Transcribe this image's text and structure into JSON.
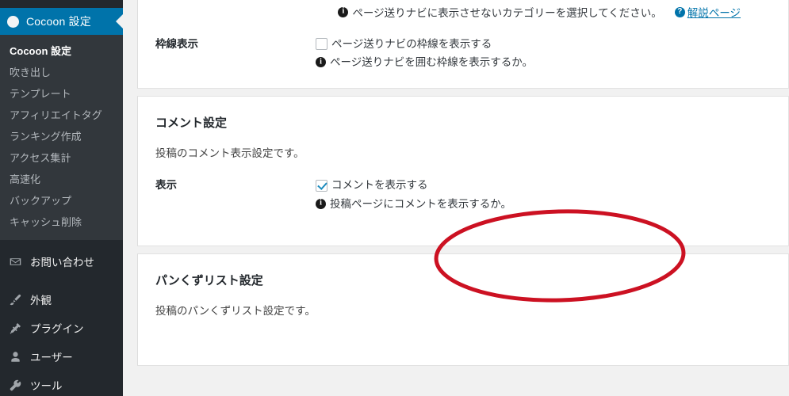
{
  "sidebar": {
    "current_menu": {
      "label": "Cocoon 設定",
      "icon": "circle-icon",
      "accent_color": "#0073aa"
    },
    "submenu": [
      {
        "label": "Cocoon 設定",
        "current": true
      },
      {
        "label": "吹き出し",
        "current": false
      },
      {
        "label": "テンプレート",
        "current": false
      },
      {
        "label": "アフィリエイトタグ",
        "current": false
      },
      {
        "label": "ランキング作成",
        "current": false
      },
      {
        "label": "アクセス集計",
        "current": false
      },
      {
        "label": "高速化",
        "current": false
      },
      {
        "label": "バックアップ",
        "current": false
      },
      {
        "label": "キャッシュ削除",
        "current": false
      }
    ],
    "items": [
      {
        "label": "お問い合わせ",
        "icon": "mail-icon"
      },
      {
        "label": "外観",
        "icon": "paintbrush-icon"
      },
      {
        "label": "プラグイン",
        "icon": "plug-icon"
      },
      {
        "label": "ユーザー",
        "icon": "user-icon"
      },
      {
        "label": "ツール",
        "icon": "wrench-icon"
      }
    ]
  },
  "panels": {
    "paging_nav": {
      "top_note": {
        "info_icon": "info-icon",
        "text": "ページ送りナビに表示させないカテゴリーを選択してください。",
        "help_icon": "help-icon",
        "link_label": "解説ページ"
      },
      "row": {
        "label": "枠線表示",
        "checkbox": {
          "checked": false,
          "label": "ページ送りナビの枠線を表示する"
        },
        "hint": {
          "icon": "info-icon",
          "text": "ページ送りナビを囲む枠線を表示するか。"
        }
      }
    },
    "comment_settings": {
      "heading": "コメント設定",
      "description": "投稿のコメント表示設定です。",
      "row": {
        "label": "表示",
        "checkbox": {
          "checked": true,
          "label": "コメントを表示する"
        },
        "hint": {
          "icon": "info-icon",
          "text": "投稿ページにコメントを表示するか。"
        }
      }
    },
    "breadcrumb_settings": {
      "heading": "パンくずリスト設定",
      "description": "投稿のパンくずリスト設定です。"
    }
  },
  "annotation": {
    "type": "ellipse",
    "color": "#cc1122",
    "stroke_width": 5,
    "target": "comment-display-checkbox-group"
  }
}
